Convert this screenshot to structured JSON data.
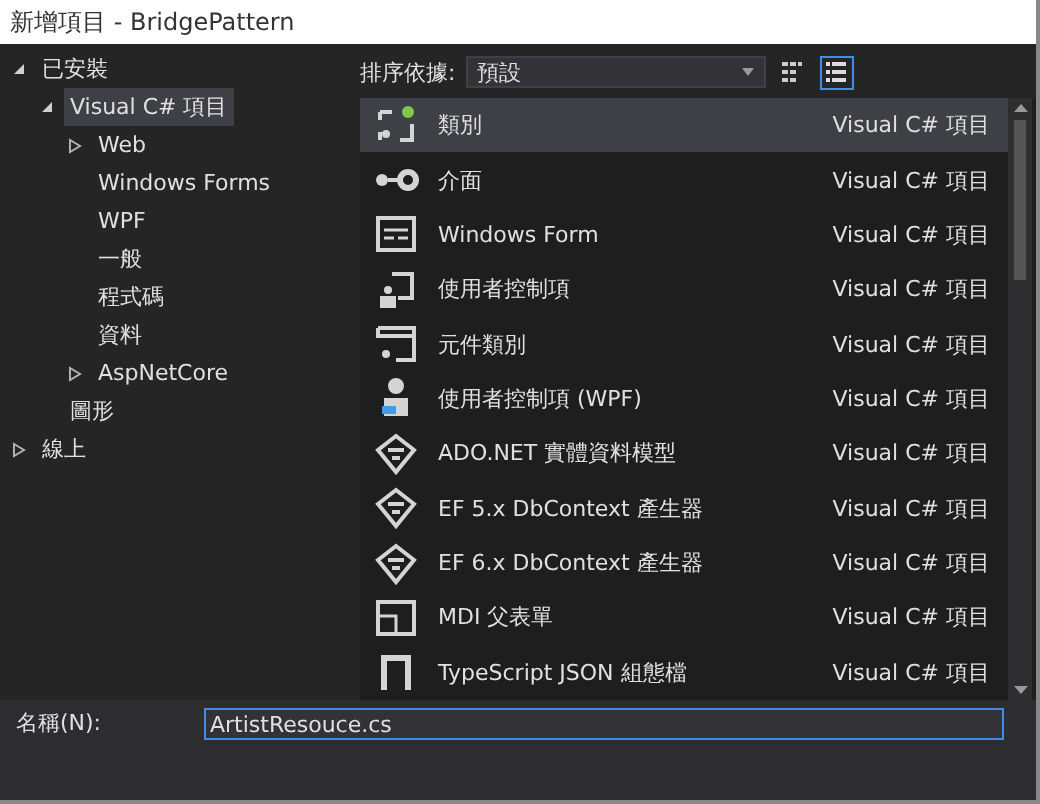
{
  "window": {
    "title": "新增項目 - BridgePattern"
  },
  "tree": [
    {
      "label": "已安裝",
      "expanded": true,
      "selected": false,
      "children": [
        {
          "label": "Visual C# 項目",
          "expanded": true,
          "selected": true,
          "children": [
            {
              "label": "Web",
              "expanded": false,
              "selected": false
            },
            {
              "label": "Windows Forms",
              "selected": false
            },
            {
              "label": "WPF",
              "selected": false
            },
            {
              "label": "一般",
              "selected": false
            },
            {
              "label": "程式碼",
              "selected": false
            },
            {
              "label": "資料",
              "selected": false
            },
            {
              "label": "AspNetCore",
              "expanded": false,
              "selected": false
            }
          ]
        },
        {
          "label": "圖形",
          "selected": false
        }
      ]
    },
    {
      "label": "線上",
      "expanded": false,
      "selected": false
    }
  ],
  "toolbar": {
    "sort_label": "排序依據:",
    "sort_value": "預設",
    "views": [
      {
        "kind": "grid",
        "selected": false
      },
      {
        "kind": "list",
        "selected": true
      }
    ]
  },
  "templates": [
    {
      "kind": "class",
      "name": "類別",
      "category": "Visual C# 項目",
      "selected": true
    },
    {
      "kind": "interface",
      "name": "介面",
      "category": "Visual C# 項目",
      "selected": false
    },
    {
      "kind": "form",
      "name": "Windows Form",
      "category": "Visual C# 項目",
      "selected": false
    },
    {
      "kind": "usercontrol",
      "name": "使用者控制項",
      "category": "Visual C# 項目",
      "selected": false
    },
    {
      "kind": "component",
      "name": "元件類別",
      "category": "Visual C# 項目",
      "selected": false
    },
    {
      "kind": "wpf",
      "name": "使用者控制項 (WPF)",
      "category": "Visual C# 項目",
      "selected": false
    },
    {
      "kind": "model",
      "name": "ADO.NET 實體資料模型",
      "category": "Visual C# 項目",
      "selected": false
    },
    {
      "kind": "model",
      "name": "EF 5.x DbContext 產生器",
      "category": "Visual C# 項目",
      "selected": false
    },
    {
      "kind": "model",
      "name": "EF 6.x DbContext 產生器",
      "category": "Visual C# 項目",
      "selected": false
    },
    {
      "kind": "mdi",
      "name": "MDI 父表單",
      "category": "Visual C# 項目",
      "selected": false
    },
    {
      "kind": "json",
      "name": "TypeScript JSON 組態檔",
      "category": "Visual C# 項目",
      "selected": false
    }
  ],
  "name_field": {
    "label": "名稱(N):",
    "value": "ArtistResouce.cs"
  }
}
